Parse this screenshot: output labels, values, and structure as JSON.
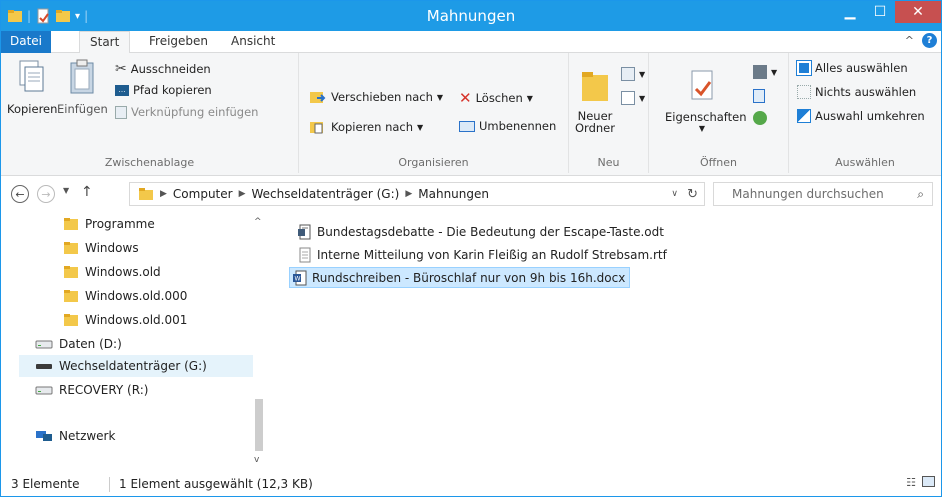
{
  "window": {
    "title": "Mahnungen"
  },
  "tabs": {
    "datei": "Datei",
    "start": "Start",
    "freigeben": "Freigeben",
    "ansicht": "Ansicht"
  },
  "ribbon": {
    "zwischenablage": {
      "label": "Zwischenablage",
      "kopieren": "Kopieren",
      "einfuegen": "Einfügen",
      "ausschneiden": "Ausschneiden",
      "pfad_kopieren": "Pfad kopieren",
      "verknuepfung": "Verknüpfung einfügen"
    },
    "organisieren": {
      "label": "Organisieren",
      "verschieben": "Verschieben nach",
      "kopieren_nach": "Kopieren nach",
      "loeschen": "Löschen",
      "umbenennen": "Umbenennen"
    },
    "neu": {
      "label": "Neu",
      "neuer_ordner_1": "Neuer",
      "neuer_ordner_2": "Ordner"
    },
    "oeffnen": {
      "label": "Öffnen",
      "eigenschaften": "Eigenschaften"
    },
    "auswaehlen": {
      "label": "Auswählen",
      "alles": "Alles auswählen",
      "nichts": "Nichts auswählen",
      "umkehren": "Auswahl umkehren"
    }
  },
  "address": {
    "crumbs": [
      "Computer",
      "Wechseldatenträger (G:)",
      "Mahnungen"
    ],
    "search_placeholder": "Mahnungen durchsuchen"
  },
  "nav": {
    "items": [
      {
        "label": "Programme",
        "type": "folder"
      },
      {
        "label": "Windows",
        "type": "folder"
      },
      {
        "label": "Windows.old",
        "type": "folder"
      },
      {
        "label": "Windows.old.000",
        "type": "folder"
      },
      {
        "label": "Windows.old.001",
        "type": "folder"
      },
      {
        "label": "Daten (D:)",
        "type": "drive"
      },
      {
        "label": "Wechseldatenträger (G:)",
        "type": "removable"
      },
      {
        "label": "RECOVERY (R:)",
        "type": "drive"
      },
      {
        "label": "Netzwerk",
        "type": "network"
      }
    ]
  },
  "files": [
    {
      "name": "Bundestagsdebatte - Die Bedeutung der Escape-Taste.odt",
      "icon": "odt-file-icon"
    },
    {
      "name": "Interne Mitteilung von Karin Fleißig an Rudolf Strebsam.rtf",
      "icon": "rtf-file-icon"
    },
    {
      "name": "Rundschreiben - Büroschlaf nur von 9h bis 16h.docx",
      "icon": "docx-file-icon"
    }
  ],
  "status": {
    "count": "3 Elemente",
    "selected": "1 Element ausgewählt (12,3 KB)"
  },
  "colors": {
    "accent": "#1e9be6",
    "selection": "#cce8ff",
    "folder": "#e8b53c"
  }
}
